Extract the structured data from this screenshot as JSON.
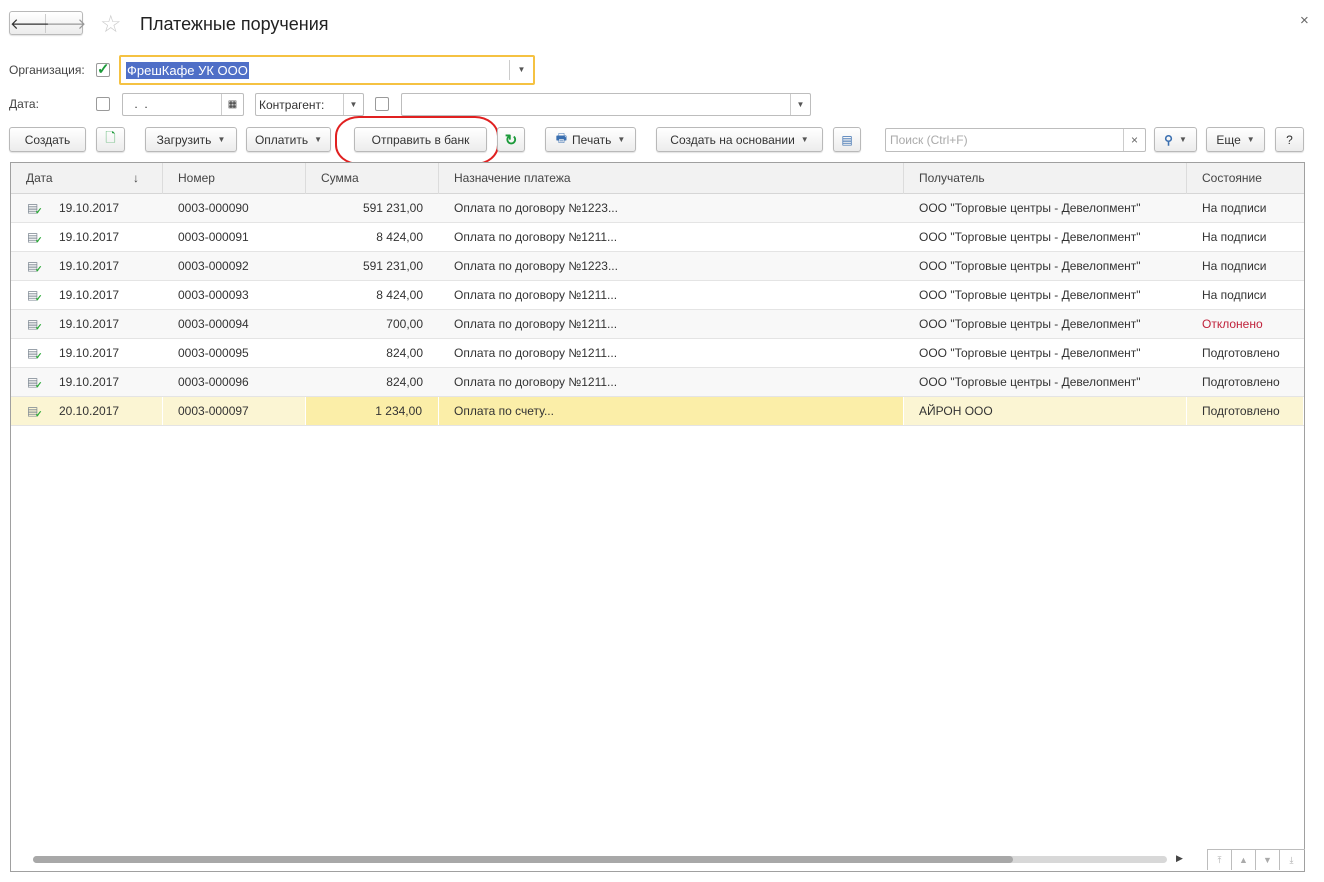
{
  "header": {
    "title": "Платежные поручения",
    "back_icon": "arrow-left",
    "forward_icon": "arrow-right",
    "favorite_icon": "star",
    "close": "×"
  },
  "filters": {
    "organization_label": "Организация:",
    "organization_value": "ФрешКафе УК ООО",
    "date_label": "Дата:",
    "date_value": " .  . ",
    "counterparty_label": "Контрагент:",
    "counterparty_value": ""
  },
  "toolbar": {
    "create": "Создать",
    "load": "Загрузить",
    "pay": "Оплатить",
    "send_to_bank": "Отправить в банк",
    "print": "Печать",
    "create_based_on": "Создать на основании",
    "search_placeholder": "Поиск (Ctrl+F)",
    "search_clear": "×",
    "more": "Еще",
    "help": "?"
  },
  "columns": [
    "Дата",
    "Номер",
    "Сумма",
    "Назначение платежа",
    "Получатель",
    "Состояние"
  ],
  "sort_indicator": "↓",
  "rows": [
    {
      "date": "19.10.2017",
      "number": "0003-000090",
      "sum": "591 231,00",
      "purpose": "Оплата по договору №1223...",
      "recipient": "ООО \"Торговые центры - Девелопмент\"",
      "status": "На подписи"
    },
    {
      "date": "19.10.2017",
      "number": "0003-000091",
      "sum": "8 424,00",
      "purpose": "Оплата по договору №1211...",
      "recipient": "ООО \"Торговые центры - Девелопмент\"",
      "status": "На подписи"
    },
    {
      "date": "19.10.2017",
      "number": "0003-000092",
      "sum": "591 231,00",
      "purpose": "Оплата по договору №1223...",
      "recipient": "ООО \"Торговые центры - Девелопмент\"",
      "status": "На подписи"
    },
    {
      "date": "19.10.2017",
      "number": "0003-000093",
      "sum": "8 424,00",
      "purpose": "Оплата по договору №1211...",
      "recipient": "ООО \"Торговые центры - Девелопмент\"",
      "status": "На подписи"
    },
    {
      "date": "19.10.2017",
      "number": "0003-000094",
      "sum": "700,00",
      "purpose": "Оплата по договору №1211...",
      "recipient": "ООО \"Торговые центры - Девелопмент\"",
      "status": "Отклонено"
    },
    {
      "date": "19.10.2017",
      "number": "0003-000095",
      "sum": "824,00",
      "purpose": "Оплата по договору №1211...",
      "recipient": "ООО \"Торговые центры - Девелопмент\"",
      "status": "Подготовлено"
    },
    {
      "date": "19.10.2017",
      "number": "0003-000096",
      "sum": "824,00",
      "purpose": "Оплата по договору №1211...",
      "recipient": "ООО \"Торговые центры - Девелопмент\"",
      "status": "Подготовлено"
    },
    {
      "date": "20.10.2017",
      "number": "0003-000097",
      "sum": "1 234,00",
      "purpose": "Оплата по счету...",
      "recipient": "АЙРОН ООО",
      "status": "Подготовлено"
    }
  ],
  "colors": {
    "accent_yellow": "#f5c242",
    "selection": "#4f6fc7",
    "rejected": "#c0223b",
    "highlight_ring": "#e02020",
    "selected_row": "#fbf5d3"
  }
}
